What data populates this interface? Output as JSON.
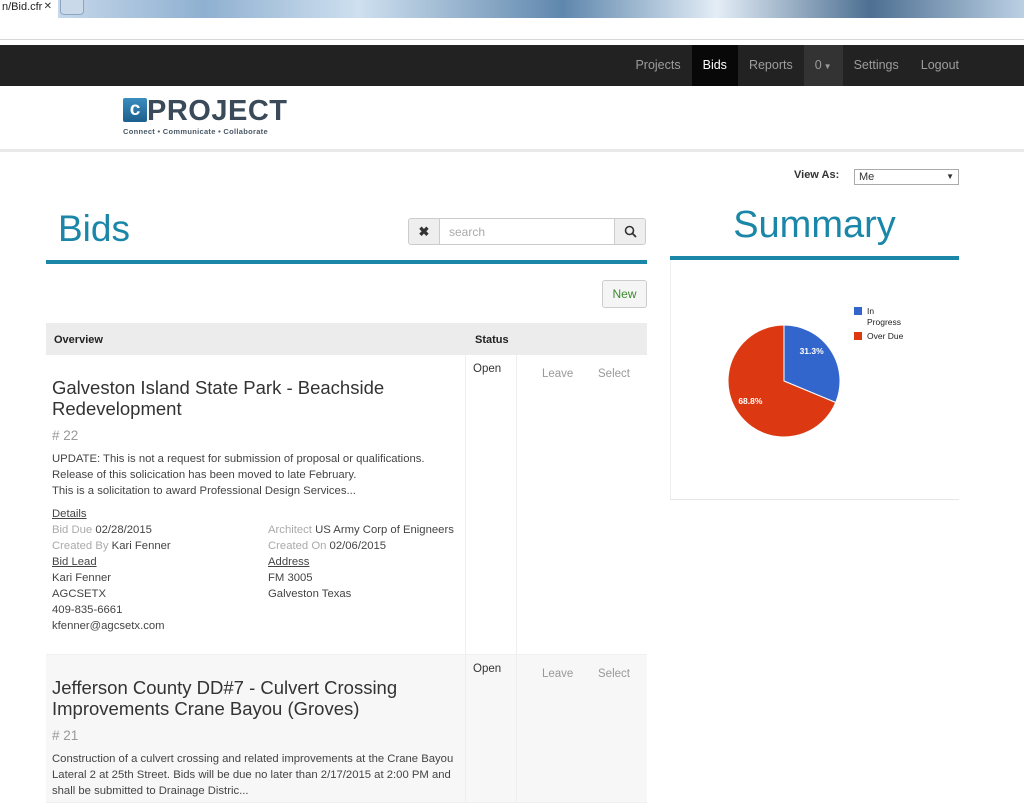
{
  "browser": {
    "tab_title": "n/Bid.cfr",
    "tab_close": "✕"
  },
  "navbar": {
    "items": [
      {
        "label": "Projects",
        "active": false
      },
      {
        "label": "Bids",
        "active": true
      },
      {
        "label": "Reports",
        "active": false
      },
      {
        "label": "0",
        "active": false,
        "dropdown": true
      },
      {
        "label": "Settings",
        "active": false
      },
      {
        "label": "Logout",
        "active": false
      }
    ]
  },
  "brand": {
    "logo_letter": "c",
    "logo_text": "PROJECT",
    "tagline": "Connect • Communicate • Collaborate"
  },
  "view_as": {
    "label": "View As:",
    "selected": "Me"
  },
  "bids": {
    "title": "Bids",
    "search_placeholder": "search",
    "new_label": "New",
    "columns": {
      "overview": "Overview",
      "status": "Status"
    },
    "rows": [
      {
        "title": "Galveston Island State Park - Beachside Redevelopment",
        "number": "# 22",
        "description": [
          "UPDATE: This is not a request for submission of proposal or qualifications.",
          "Release of this solicication has been moved to late February.",
          "This is a solicitation to award Professional Design Services..."
        ],
        "status": "Open",
        "leave_label": "Leave",
        "select_label": "Select",
        "details_label": "Details",
        "bid_due_label": "Bid Due",
        "bid_due": "02/28/2015",
        "created_by_label": "Created By",
        "created_by": "Kari Fenner",
        "architect_label": "Architect",
        "architect": "US Army Corp of Enigneers",
        "created_on_label": "Created On",
        "created_on": "02/06/2015",
        "bid_lead_label": "Bid Lead",
        "bid_lead": [
          "Kari Fenner",
          "AGCSETX",
          "409-835-6661",
          "kfenner@agcsetx.com"
        ],
        "address_label": "Address",
        "address": [
          "FM 3005",
          "Galveston Texas"
        ]
      },
      {
        "title": "Jefferson County DD#7 - Culvert Crossing Improvements Crane Bayou (Groves)",
        "number": "# 21",
        "description": [
          "Construction of a culvert crossing and related improvements at the Crane Bayou",
          "Lateral 2 at 25th Street. Bids will be due no later than 2/17/2015 at 2:00 PM and",
          "shall be submitted to Drainage Distric..."
        ],
        "status": "Open",
        "leave_label": "Leave",
        "select_label": "Select"
      }
    ]
  },
  "summary": {
    "title": "Summary"
  },
  "chart_data": {
    "type": "pie",
    "title": "",
    "legend_position": "right",
    "series": [
      {
        "name": "In Progress",
        "value": 31.3,
        "label": "31.3%",
        "color": "#3366cc"
      },
      {
        "name": "Over Due",
        "value": 68.8,
        "label": "68.8%",
        "color": "#dc3912"
      }
    ]
  }
}
